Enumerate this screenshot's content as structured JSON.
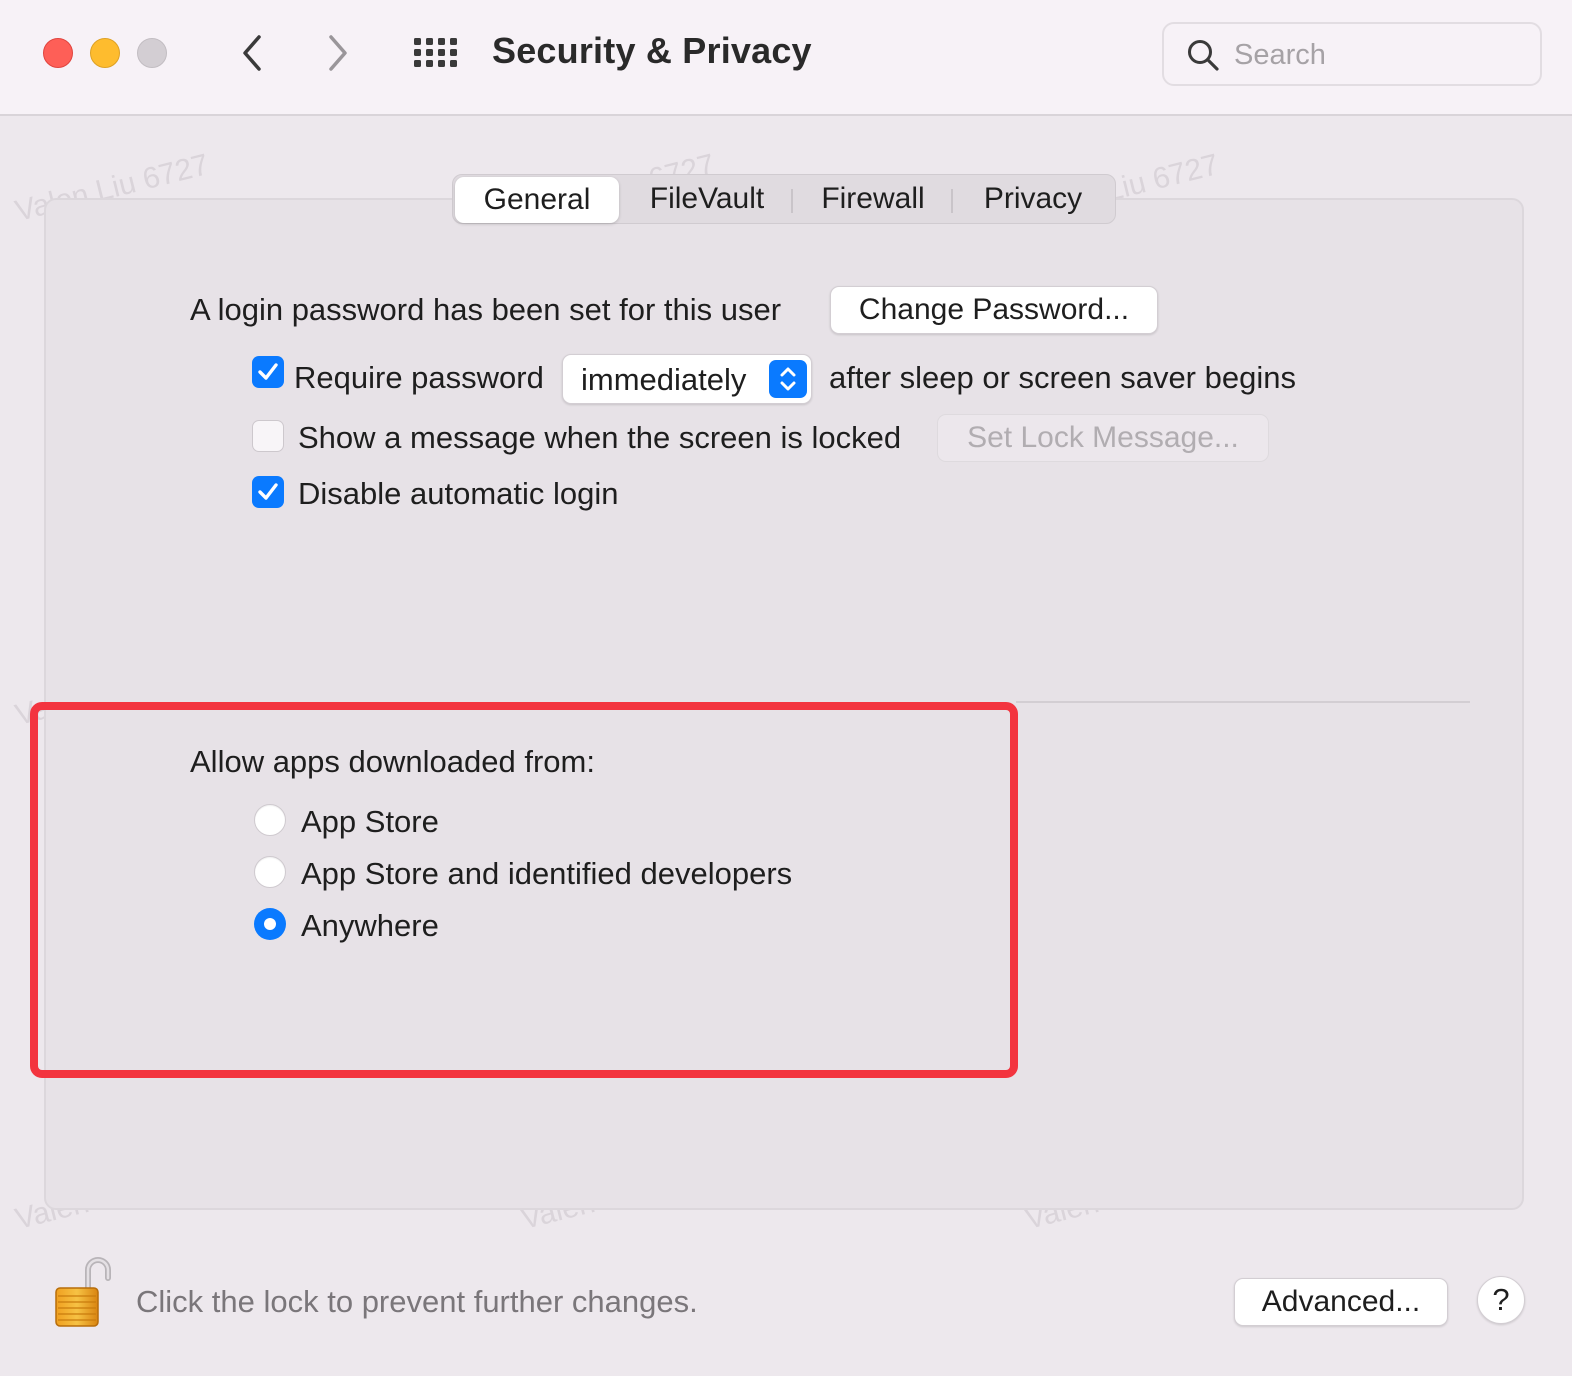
{
  "window": {
    "title": "Security & Privacy",
    "search_placeholder": "Search"
  },
  "tabs": [
    {
      "label": "General",
      "active": true
    },
    {
      "label": "FileVault",
      "active": false
    },
    {
      "label": "Firewall",
      "active": false
    },
    {
      "label": "Privacy",
      "active": false
    }
  ],
  "general": {
    "password_status": "A login password has been set for this user",
    "change_password_button": "Change Password...",
    "require_password": {
      "label": "Require password",
      "checked": true
    },
    "require_password_delay": "immediately",
    "require_password_suffix": "after sleep or screen saver begins",
    "show_message": {
      "label": "Show a message when the screen is locked",
      "checked": false
    },
    "set_lock_message_button": "Set Lock Message...",
    "disable_auto_login": {
      "label": "Disable automatic login",
      "checked": true
    }
  },
  "downloads": {
    "heading": "Allow apps downloaded from:",
    "options": [
      {
        "label": "App Store",
        "selected": false
      },
      {
        "label": "App Store and identified developers",
        "selected": false
      },
      {
        "label": "Anywhere",
        "selected": true
      }
    ]
  },
  "footer": {
    "lock_text": "Click the lock to prevent further changes.",
    "advanced_button": "Advanced...",
    "help_button": "?"
  },
  "watermark_text": "Valen Liu 6727",
  "colors": {
    "accent": "#0a7aff",
    "highlight_box": "#f3343f",
    "close": "#fe5f57",
    "minimize": "#febc2e",
    "zoom_inactive": "#d3ced3"
  }
}
